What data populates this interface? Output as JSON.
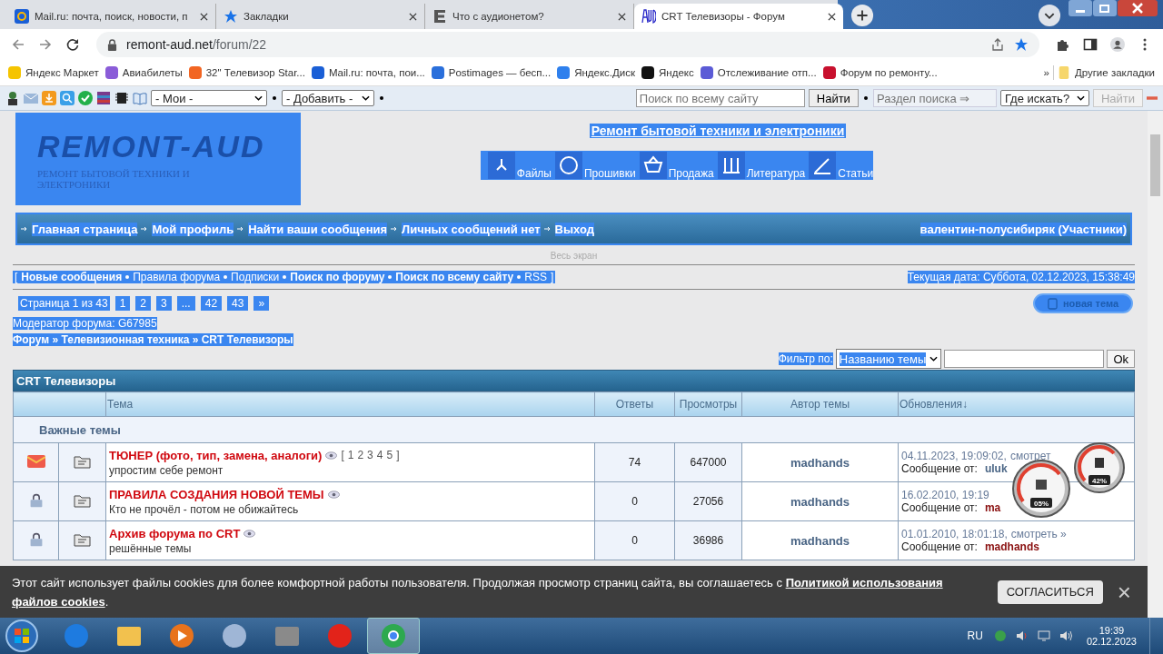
{
  "browser": {
    "tabs": [
      {
        "kind": "mail",
        "title": "Mail.ru: почта, поиск, новости, п",
        "selected": false
      },
      {
        "kind": "star",
        "title": "Закладки",
        "selected": false
      },
      {
        "kind": "e",
        "title": "Что с аудионетом?",
        "selected": false
      },
      {
        "kind": "aud",
        "title": "CRT Телевизоры - Форум",
        "selected": true
      }
    ],
    "address": {
      "host": "remont-aud.net",
      "path": "/forum/22"
    },
    "bookmarks": [
      {
        "title": "Яндекс Маркет",
        "color": "#f5c400"
      },
      {
        "title": "Авиабилеты",
        "color": "#8a5cd8"
      },
      {
        "title": "32\" Телевизор Star...",
        "color": "#f26522"
      },
      {
        "title": "Mail.ru: почта, пои...",
        "color": "#1a5fd6"
      },
      {
        "title": "Postimages — бесп...",
        "color": "#2a6fdb"
      },
      {
        "title": "Яндекс.Диск",
        "color": "#2f80ed"
      },
      {
        "title": "Яндекс",
        "color": "#111111"
      },
      {
        "title": "Отслеживание отп...",
        "color": "#5b5bd6"
      },
      {
        "title": "Форум по ремонту...",
        "color": "#c8102e"
      }
    ],
    "more": "»",
    "other_bookmarks": "Другие закладки"
  },
  "site_toolbar": {
    "my_select": "- Мои -",
    "add_select": "- Добавить -",
    "search_placeholder": "Поиск по всему сайту",
    "search_button": "Найти",
    "section_placeholder": "Раздел поиска ⇒",
    "where_select": "Где искать?",
    "find_button": "Найти",
    "find_disabled": true
  },
  "header": {
    "logo_title": "REMONT-AUD",
    "logo_subtitle": "РЕМОНТ БЫТОВОЙ ТЕХНИКИ И ЭЛЕКТРОНИКИ",
    "slogan": "Ремонт бытовой техники и электроники",
    "menu": [
      {
        "kind": "files",
        "label": "Файлы"
      },
      {
        "kind": "firmware",
        "label": "Прошивки"
      },
      {
        "kind": "sale",
        "label": "Продажа"
      },
      {
        "kind": "books",
        "label": "Литература"
      },
      {
        "kind": "articles",
        "label": "Статьи"
      }
    ]
  },
  "nav": {
    "links": [
      "Главная страница",
      "Мой профиль",
      "Найти ваши сообщения",
      "Личных сообщений нет",
      "Выход"
    ],
    "user": "валентин-полусибиряк (Участники)"
  },
  "fullscreen": "Весь экран",
  "quick_links": {
    "open": "[",
    "close": "]",
    "items": [
      {
        "text": "Новые сообщения",
        "bold": true
      },
      {
        "text": "Правила форума",
        "bold": false
      },
      {
        "text": "Подписки",
        "bold": false
      },
      {
        "text": "Поиск по форуму",
        "bold": true
      },
      {
        "text": "Поиск по всему сайту",
        "bold": true
      },
      {
        "text": "RSS",
        "bold": false
      }
    ],
    "date": "Текущая дата: Суббота, 02.12.2023, 15:38:49"
  },
  "pagination": {
    "label": "Страница 1 из 43",
    "pages": [
      "1",
      "2",
      "3",
      "...",
      "42",
      "43",
      "»"
    ]
  },
  "new_topic": "новая тема",
  "moderator": "Модератор форума: G67985",
  "breadcrumbs": "Форум » Телевизионная техника » CRT Телевизоры",
  "filter": {
    "label": "Фильтр по:",
    "select": "Названию темы",
    "button": "Ok"
  },
  "table": {
    "title": "CRT Телевизоры",
    "columns": [
      "Тема",
      "Ответы",
      "Просмотры",
      "Автор темы",
      "Обновления↓"
    ],
    "section": "Важные темы",
    "rows": [
      {
        "kind": "new",
        "title": "ТЮНЕР (фото, тип, замена, аналоги)",
        "pages_open": "[",
        "pages": [
          "1",
          "2",
          "3",
          "4",
          "5"
        ],
        "pages_close": "]",
        "description": "упростим себе ремонт",
        "replies": "74",
        "views": "647000",
        "author": "madhands",
        "updated": "04.11.2023, 19:09:02,",
        "view_link": "смотрет",
        "from_label": "Сообщение от:",
        "from": "uluk",
        "color": "#4a6585"
      },
      {
        "kind": "locked",
        "title": "ПРАВИЛА СОЗДАНИЯ НОВОЙ ТЕМЫ",
        "description": "Кто не прочёл - потом не обижайтесь",
        "replies": "0",
        "views": "27056",
        "author": "madhands",
        "updated": "16.02.2010, 19:19",
        "from_label": "Сообщение от:",
        "from": "ma",
        "color": "#8a1010"
      },
      {
        "kind": "locked",
        "title": "Архив форума по CRT",
        "description": "решённые темы",
        "replies": "0",
        "views": "36986",
        "author": "madhands",
        "updated": "01.01.2010, 18:01:18,",
        "view_link": "смотреть »",
        "from_label": "Сообщение от:",
        "from": "madhands",
        "color": "#8a1010"
      }
    ]
  },
  "gadget": {
    "readings": [
      "05%",
      "42%"
    ]
  },
  "cookie_banner": {
    "text": "Этот сайт использует файлы cookies для более комфортной работы пользователя. Продолжая просмотр страниц сайта, вы соглашаетесь с ",
    "link": [
      "Политикой использования",
      "файлов cookies"
    ],
    "end": ".",
    "button": "СОГЛАСИТЬСЯ",
    "close": "×"
  },
  "taskbar": {
    "apps": [
      {
        "kind": "ie",
        "selected": false
      },
      {
        "kind": "folder",
        "selected": false
      },
      {
        "kind": "media",
        "selected": false
      },
      {
        "kind": "scissors",
        "selected": false
      },
      {
        "kind": "wall",
        "selected": false
      },
      {
        "kind": "yandex",
        "selected": false
      },
      {
        "kind": "chrome",
        "selected": true
      }
    ],
    "language": "RU",
    "time": "19:39",
    "date": "02.12.2023"
  }
}
